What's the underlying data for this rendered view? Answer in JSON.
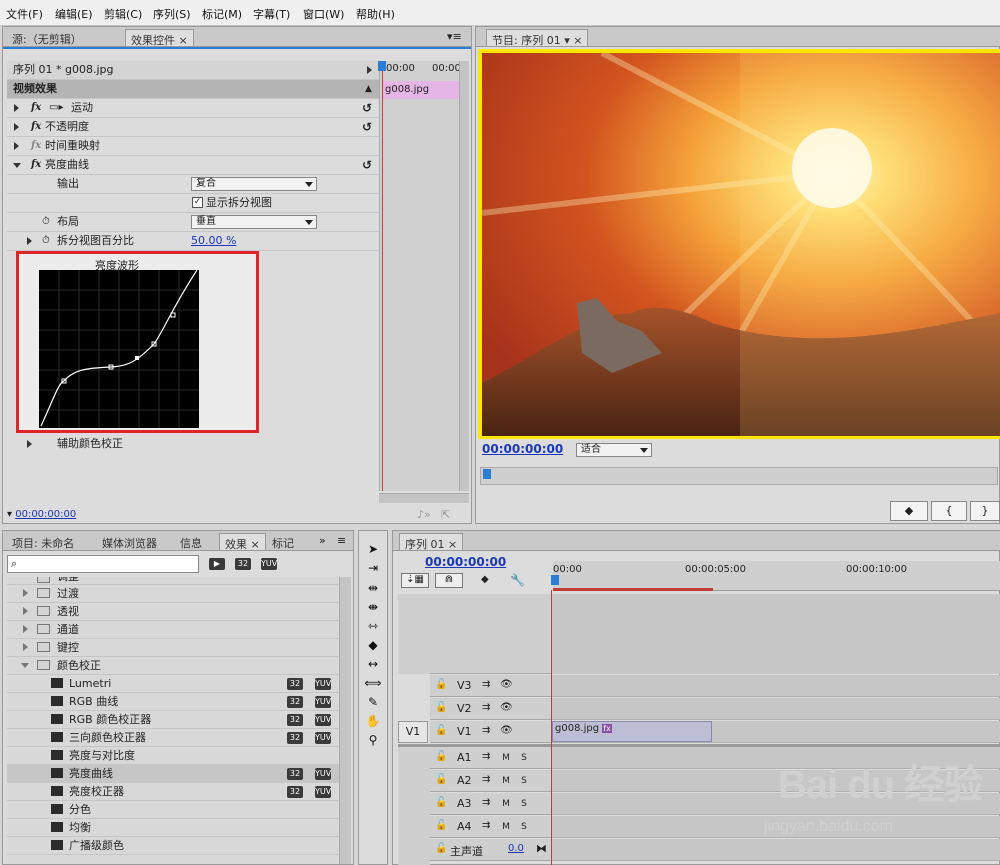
{
  "menu": [
    "文件(F)",
    "编辑(E)",
    "剪辑(C)",
    "序列(S)",
    "标记(M)",
    "字幕(T)",
    "窗口(W)",
    "帮助(H)"
  ],
  "source_panel": {
    "tabs": [
      "源:（无剪辑）",
      "效果控件"
    ],
    "clip_header": "序列 01 * g008.jpg",
    "time_start": "00:00",
    "time_end": "00:00",
    "clip_name": "g008.jpg",
    "section_label": "视频效果",
    "effects": [
      "运动",
      "不透明度",
      "时间重映射",
      "亮度曲线"
    ],
    "props": {
      "output_label": "输出",
      "output_value": "复合",
      "split_view_label": "显示拆分视图",
      "layout_label": "布局",
      "layout_value": "垂直",
      "split_pct_label": "拆分视图百分比",
      "split_pct_value": "50.00 %"
    },
    "curve_title": "亮度波形",
    "secondary": "辅助颜色校正",
    "timecode": "00:00:00:00"
  },
  "program": {
    "tab": "节目: 序列 01",
    "timecode": "00:00:00:00",
    "fit": "适合",
    "marker_btn": "marker-icon",
    "in_btn": "{",
    "out_btn": "}"
  },
  "project": {
    "tabs": [
      "项目: 未命名",
      "媒体浏览器",
      "信息",
      "效果",
      "标记"
    ],
    "search_placeholder": "",
    "badge_32": "32",
    "badge_yuv": "YUV",
    "folders": [
      "调整",
      "过渡",
      "透视",
      "通道",
      "键控",
      "颜色校正"
    ],
    "items": [
      {
        "name": "Lumetri",
        "b32": true,
        "yuv": true
      },
      {
        "name": "RGB 曲线",
        "b32": true,
        "yuv": true
      },
      {
        "name": "RGB 颜色校正器",
        "b32": true,
        "yuv": true
      },
      {
        "name": "三向颜色校正器",
        "b32": true,
        "yuv": true
      },
      {
        "name": "亮度与对比度",
        "b32": false,
        "yuv": false
      },
      {
        "name": "亮度曲线",
        "b32": true,
        "yuv": true
      },
      {
        "name": "亮度校正器",
        "b32": true,
        "yuv": true
      },
      {
        "name": "分色",
        "b32": false,
        "yuv": false
      },
      {
        "name": "均衡",
        "b32": false,
        "yuv": false
      },
      {
        "name": "广播级颜色",
        "b32": false,
        "yuv": false
      }
    ]
  },
  "timeline": {
    "tab": "序列 01",
    "timecode": "00:00:00:00",
    "ruler": [
      "00:00",
      "00:00:05:00",
      "00:00:10:00"
    ],
    "video_tracks": [
      "V3",
      "V2",
      "V1"
    ],
    "source_track": "V1",
    "audio_tracks": [
      "A1",
      "A2",
      "A3",
      "A4"
    ],
    "master": "主声道",
    "master_value": "0.0",
    "clip": "g008.jpg",
    "m_label": "M",
    "s_label": "S"
  },
  "watermark": {
    "logo": "Bai du 经验",
    "url": "jingyan.baidu.com"
  }
}
